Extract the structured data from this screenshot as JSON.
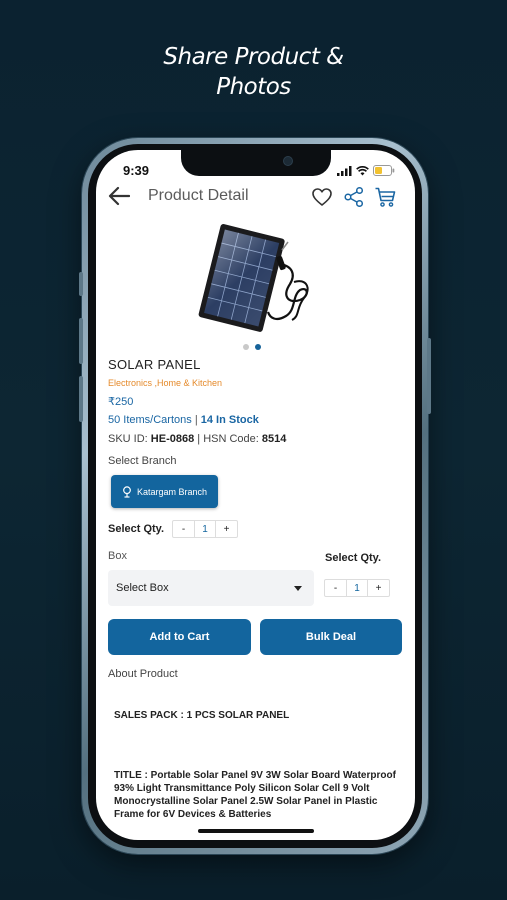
{
  "promo": {
    "line1": "Share Product &",
    "line2": "Photos"
  },
  "status_bar": {
    "time": "9:39"
  },
  "header": {
    "title": "Product Detail",
    "icons": [
      "back-arrow-icon",
      "heart-icon",
      "share-icon",
      "cart-icon"
    ]
  },
  "product": {
    "name": "SOLAR PANEL",
    "category": "Electronics ,Home & Kitchen",
    "price": "₹250",
    "items_per_carton": "50 Items/Cartons",
    "stock_separator": " | ",
    "stock": "14 In Stock",
    "sku_label": "SKU ID: ",
    "sku": "HE-0868",
    "hsn_separator": " | HSN Code: ",
    "hsn": "8514",
    "image_count": 2,
    "active_image_index": 1
  },
  "branch": {
    "label": "Select Branch",
    "selected": "Katargam Branch"
  },
  "quantity": {
    "label": "Select Qty.",
    "minus": "-",
    "value": "1",
    "plus": "+"
  },
  "box": {
    "label": "Box",
    "placeholder": "Select Box",
    "qty_label": "Select Qty.",
    "minus": "-",
    "value": "1",
    "plus": "+"
  },
  "actions": {
    "add_to_cart": "Add to Cart",
    "bulk_deal": "Bulk Deal"
  },
  "about": {
    "heading": "About Product",
    "sales_pack": "SALES PACK : 1 PCS SOLAR PANEL",
    "description": "TITLE : Portable Solar Panel 9V 3W Solar Board Waterproof 93% Light Transmittance Poly Silicon Solar Cell 9 Volt Monocrystalline Solar Panel 2.5W Solar Panel in Plastic Frame for 6V Devices & Batteries"
  },
  "colors": {
    "background": "#0b2230",
    "primary": "#13659e",
    "category": "#e58a2b"
  }
}
